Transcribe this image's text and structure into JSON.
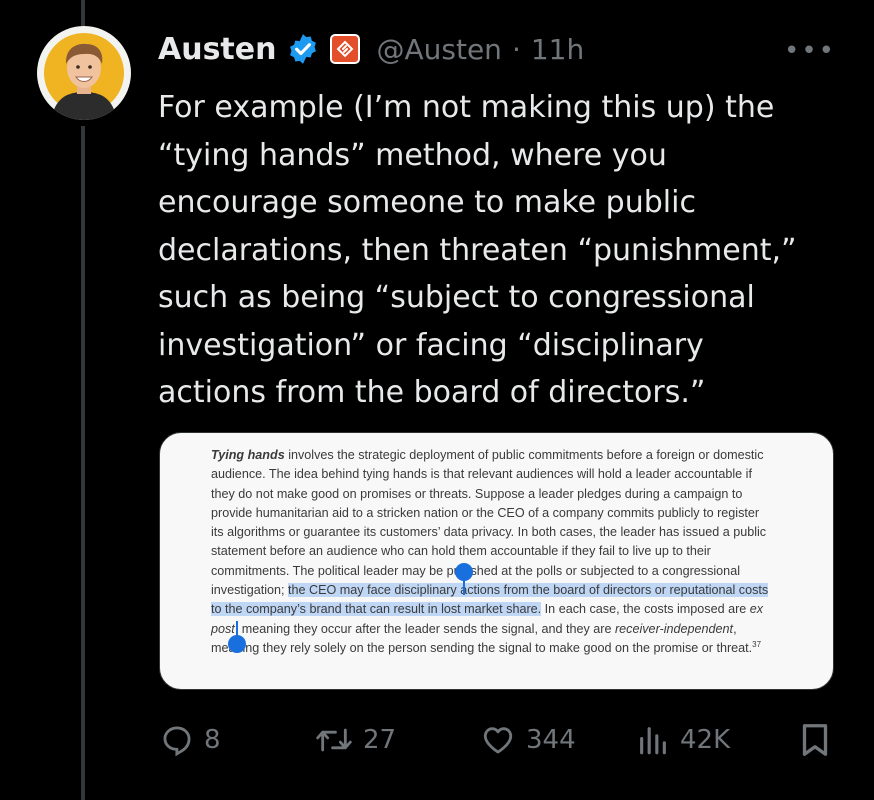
{
  "post": {
    "display_name": "Austen",
    "handle": "@Austen",
    "separator": "·",
    "time": "11h",
    "more_label": "•••",
    "text": "For example (I’m not making this up) the\n“tying hands” method, where you\nencourage someone to make public\ndeclarations, then threaten “punishment,”\nsuch as being “subject to congressional\ninvestigation” or facing “disciplinary\nactions from the board of directors.”"
  },
  "media": {
    "lead": "Tying hands",
    "p1": " involves the strategic deployment of public commitments before a foreign or domestic audience. The idea behind tying hands is that relevant audiences will hold a leader accountable if they do not make good on promises or threats. Suppose a leader pledges during a campaign to provide humanitarian aid to a stricken nation or the CEO of a company commits publicly to register its algorithms or guarantee its customers’ data privacy. In both cases, the leader has issued a public statement before an audience who can hold them accountable if they fail to live up to their commitments. The political leader may be punished at the polls or subjected to a congressional investigation; ",
    "highlight": "the CEO may face disciplinary actions from the board of directors or reputational costs to the company’s brand that can result in lost market share.",
    "p2a": " In each case, the costs imposed are ",
    "ital1": "ex post",
    "p2b": ", meaning they occur after the leader sends the signal, and they are ",
    "ital2": "receiver-independent",
    "p2c": ", meaning they rely solely on the person sending the signal to make good on the promise or threat.",
    "footnote": "37"
  },
  "actions": {
    "replies": "8",
    "reposts": "27",
    "likes": "344",
    "views": "42K"
  },
  "colors": {
    "background": "#000000",
    "text": "#e7e9ea",
    "muted": "#71767b",
    "verified": "#1d9bf0",
    "selection_handle": "#1a6fde",
    "selection_fill": "#bfd6f5",
    "affiliate_badge": "#e24f2a"
  },
  "icons": [
    "verified-badge-icon",
    "affiliate-badge-icon",
    "more-icon",
    "reply-icon",
    "repost-icon",
    "like-icon",
    "views-icon",
    "bookmark-icon"
  ]
}
